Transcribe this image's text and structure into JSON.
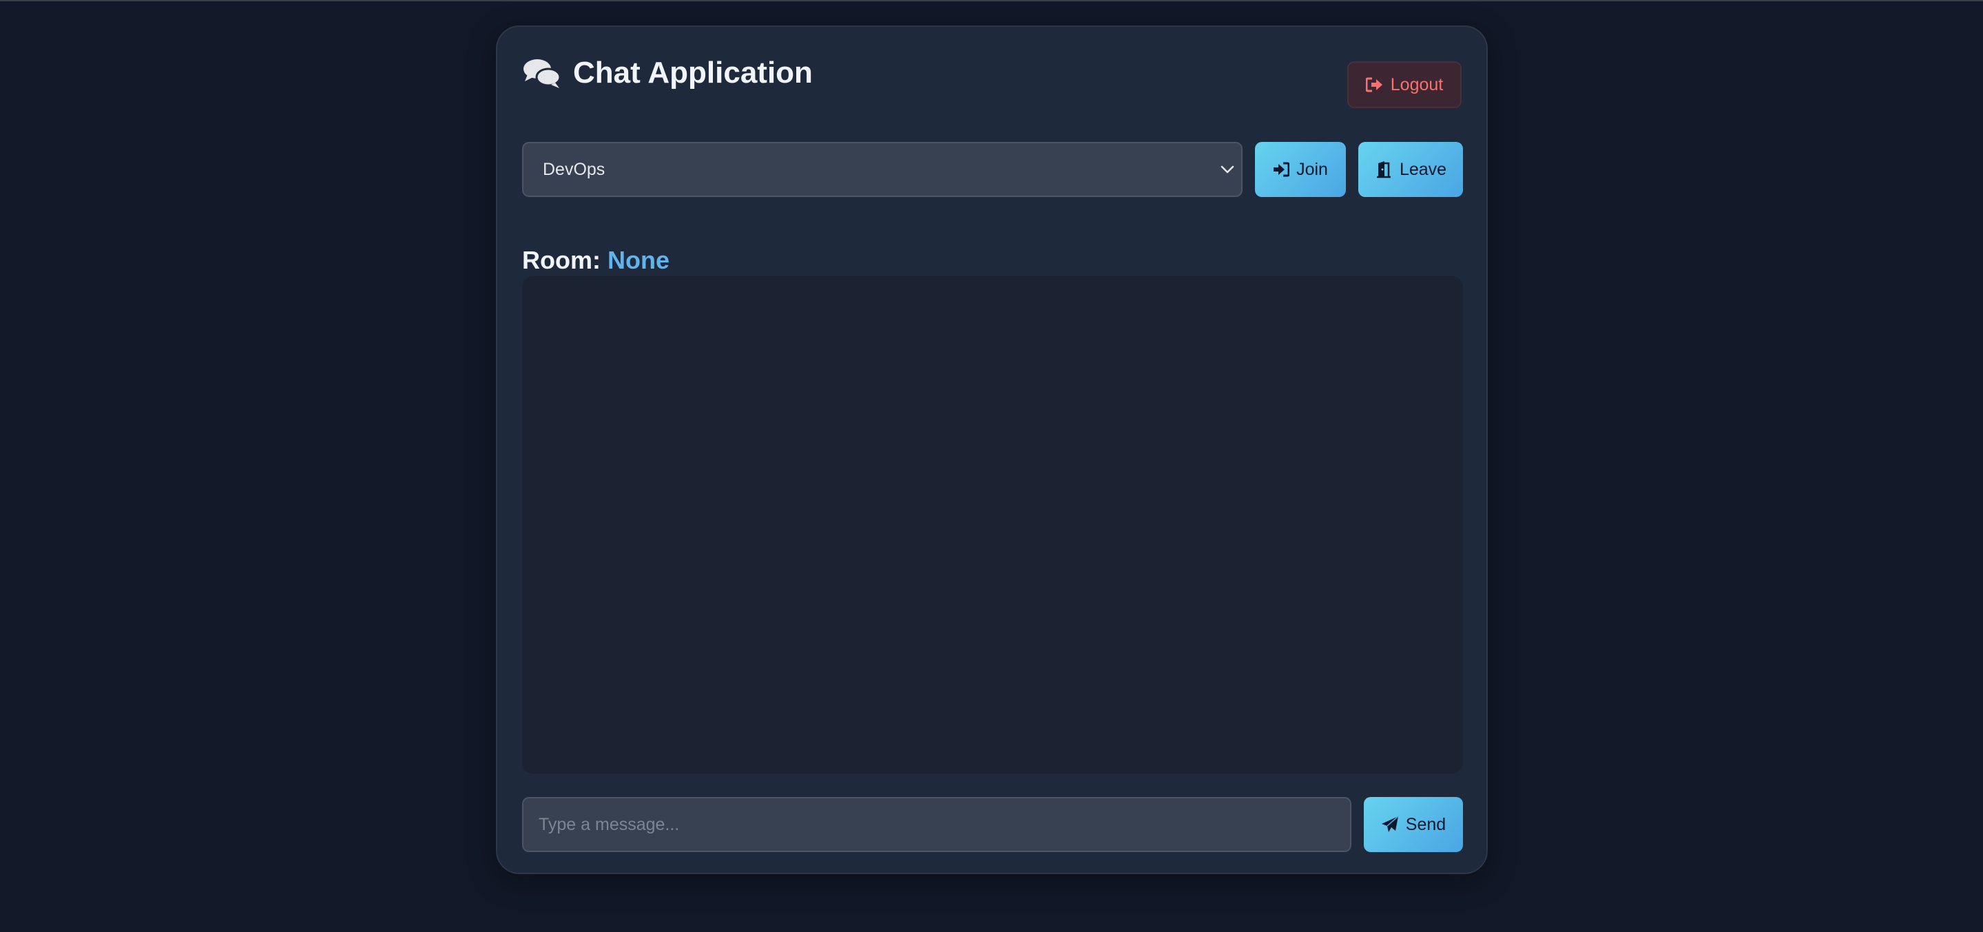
{
  "app": {
    "title": "Chat Application",
    "icon": "comments-icon"
  },
  "header": {
    "logout_label": "Logout",
    "logout_icon": "sign-out-icon"
  },
  "room_select": {
    "selected": "DevOps"
  },
  "actions": {
    "join_label": "Join",
    "join_icon": "sign-in-icon",
    "leave_label": "Leave",
    "leave_icon": "door-open-icon"
  },
  "room_status": {
    "label": "Room:",
    "value": "None"
  },
  "messages": [],
  "composer": {
    "placeholder": "Type a message...",
    "value": "",
    "send_label": "Send",
    "send_icon": "paper-plane-icon"
  },
  "colors": {
    "background": "#111827",
    "card": "#1e293b",
    "accent": "#60b4ee",
    "danger": "#f87171"
  }
}
